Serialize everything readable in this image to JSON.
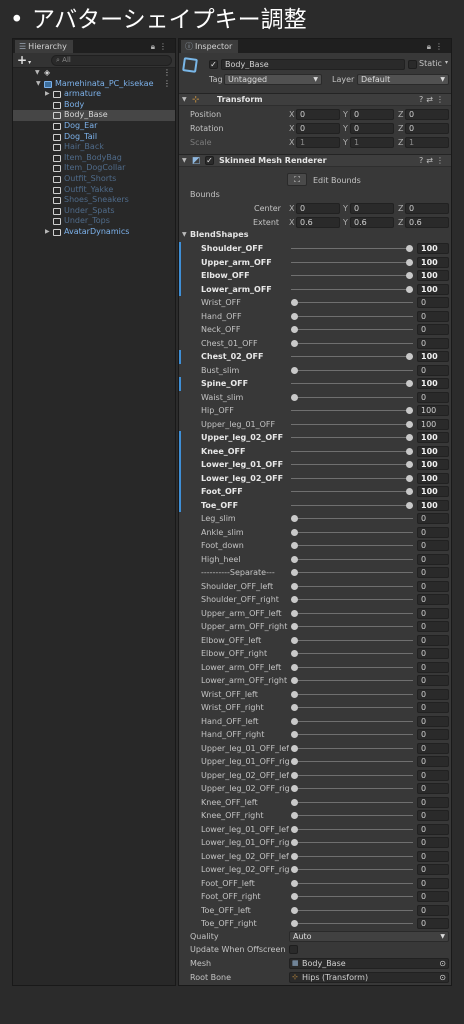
{
  "slide": {
    "bullet": "•",
    "title": "アバターシェイプキー調整"
  },
  "hierarchy": {
    "tab_label": "Hierarchy",
    "tab_icon": "list-icon",
    "lock_icon": "lock-icon",
    "menu_icon": "kebab-menu-icon",
    "add_icon": "plus-icon",
    "search_placeholder": "All",
    "scene_icon": "unity-scene-icon",
    "items": [
      {
        "name": "Mamehinata_PC_kisekae",
        "color": "#7cb1ea"
      },
      {
        "name": "armature",
        "color": "#7cb1ea"
      },
      {
        "name": "Body",
        "color": "#7cb1ea"
      },
      {
        "name": "Body_Base",
        "color": "#d8d8d8",
        "selected": true
      },
      {
        "name": "Dog_Ear",
        "color": "#7cb1ea"
      },
      {
        "name": "Dog_Tail",
        "color": "#7cb1ea"
      },
      {
        "name": "Hair_Back",
        "color": "#4f6b8a"
      },
      {
        "name": "Item_BodyBag",
        "color": "#4f6b8a"
      },
      {
        "name": "Item_DogCollar",
        "color": "#4f6b8a"
      },
      {
        "name": "Outfit_Shorts",
        "color": "#4f6b8a"
      },
      {
        "name": "Outfit_Yakke",
        "color": "#4f6b8a"
      },
      {
        "name": "Shoes_Sneakers",
        "color": "#4f6b8a"
      },
      {
        "name": "Under_Spats",
        "color": "#4f6b8a"
      },
      {
        "name": "Under_Tops",
        "color": "#4f6b8a"
      },
      {
        "name": "AvatarDynamics",
        "color": "#7cb1ea"
      }
    ]
  },
  "inspector": {
    "tab_label": "Inspector",
    "tab_icon": "info-icon",
    "object_name": "Body_Base",
    "static_label": "Static",
    "tag_label": "Tag",
    "tag_value": "Untagged",
    "layer_label": "Layer",
    "layer_value": "Default",
    "transform": {
      "title": "Transform",
      "position_label": "Position",
      "rotation_label": "Rotation",
      "scale_label": "Scale",
      "x": "X",
      "y": "Y",
      "z": "Z",
      "position": [
        "0",
        "0",
        "0"
      ],
      "rotation": [
        "0",
        "0",
        "0"
      ],
      "scale": [
        "1",
        "1",
        "1"
      ]
    },
    "smr": {
      "title": "Skinned Mesh Renderer",
      "edit_bounds": "Edit Bounds",
      "bounds_label": "Bounds",
      "center_label": "Center",
      "extent_label": "Extent",
      "center": [
        "0",
        "0",
        "0"
      ],
      "extent": [
        "0.6",
        "0.6",
        "0.6"
      ],
      "blendshapes_label": "BlendShapes",
      "quality_label": "Quality",
      "quality_value": "Auto",
      "update_offscreen_label": "Update When Offscreen",
      "mesh_label": "Mesh",
      "mesh_value": "Body_Base",
      "root_bone_label": "Root Bone",
      "root_bone_value": "Hips (Transform)"
    }
  },
  "blendshapes": [
    {
      "name": "Shoulder_OFF",
      "value": 100,
      "modified": true
    },
    {
      "name": "Upper_arm_OFF",
      "value": 100,
      "modified": true
    },
    {
      "name": "Elbow_OFF",
      "value": 100,
      "modified": true
    },
    {
      "name": "Lower_arm_OFF",
      "value": 100,
      "modified": true
    },
    {
      "name": "Wrist_OFF",
      "value": 0,
      "modified": false
    },
    {
      "name": "Hand_OFF",
      "value": 0,
      "modified": false
    },
    {
      "name": "Neck_OFF",
      "value": 0,
      "modified": false
    },
    {
      "name": "Chest_01_OFF",
      "value": 0,
      "modified": false
    },
    {
      "name": "Chest_02_OFF",
      "value": 100,
      "modified": true
    },
    {
      "name": "Bust_slim",
      "value": 0,
      "modified": false
    },
    {
      "name": "Spine_OFF",
      "value": 100,
      "modified": true
    },
    {
      "name": "Waist_slim",
      "value": 0,
      "modified": false
    },
    {
      "name": "Hip_OFF",
      "value": 100,
      "modified": false
    },
    {
      "name": "Upper_leg_01_OFF",
      "value": 100,
      "modified": false
    },
    {
      "name": "Upper_leg_02_OFF",
      "value": 100,
      "modified": true
    },
    {
      "name": "Knee_OFF",
      "value": 100,
      "modified": true
    },
    {
      "name": "Lower_leg_01_OFF",
      "value": 100,
      "modified": true
    },
    {
      "name": "Lower_leg_02_OFF",
      "value": 100,
      "modified": true
    },
    {
      "name": "Foot_OFF",
      "value": 100,
      "modified": true
    },
    {
      "name": "Toe_OFF",
      "value": 100,
      "modified": true
    },
    {
      "name": "Leg_slim",
      "value": 0,
      "modified": false
    },
    {
      "name": "Ankle_slim",
      "value": 0,
      "modified": false
    },
    {
      "name": "Foot_down",
      "value": 0,
      "modified": false
    },
    {
      "name": "High_heel",
      "value": 0,
      "modified": false
    },
    {
      "name": "----------Separate---",
      "value": 0,
      "modified": false
    },
    {
      "name": "Shoulder_OFF_left",
      "value": 0,
      "modified": false
    },
    {
      "name": "Shoulder_OFF_right",
      "value": 0,
      "modified": false
    },
    {
      "name": "Upper_arm_OFF_left",
      "value": 0,
      "modified": false
    },
    {
      "name": "Upper_arm_OFF_right",
      "value": 0,
      "modified": false
    },
    {
      "name": "Elbow_OFF_left",
      "value": 0,
      "modified": false
    },
    {
      "name": "Elbow_OFF_right",
      "value": 0,
      "modified": false
    },
    {
      "name": "Lower_arm_OFF_left",
      "value": 0,
      "modified": false
    },
    {
      "name": "Lower_arm_OFF_right",
      "value": 0,
      "modified": false
    },
    {
      "name": "Wrist_OFF_left",
      "value": 0,
      "modified": false
    },
    {
      "name": "Wrist_OFF_right",
      "value": 0,
      "modified": false
    },
    {
      "name": "Hand_OFF_left",
      "value": 0,
      "modified": false
    },
    {
      "name": "Hand_OFF_right",
      "value": 0,
      "modified": false
    },
    {
      "name": "Upper_leg_01_OFF_left",
      "value": 0,
      "modified": false
    },
    {
      "name": "Upper_leg_01_OFF_righ",
      "value": 0,
      "modified": false
    },
    {
      "name": "Upper_leg_02_OFF_left",
      "value": 0,
      "modified": false
    },
    {
      "name": "Upper_leg_02_OFF_righ",
      "value": 0,
      "modified": false
    },
    {
      "name": "Knee_OFF_left",
      "value": 0,
      "modified": false
    },
    {
      "name": "Knee_OFF_right",
      "value": 0,
      "modified": false
    },
    {
      "name": "Lower_leg_01_OFF_left",
      "value": 0,
      "modified": false
    },
    {
      "name": "Lower_leg_01_OFF_righ",
      "value": 0,
      "modified": false
    },
    {
      "name": "Lower_leg_02_OFF_left",
      "value": 0,
      "modified": false
    },
    {
      "name": "Lower_leg_02_OFF_righ",
      "value": 0,
      "modified": false
    },
    {
      "name": "Foot_OFF_left",
      "value": 0,
      "modified": false
    },
    {
      "name": "Foot_OFF_right",
      "value": 0,
      "modified": false
    },
    {
      "name": "Toe_OFF_left",
      "value": 0,
      "modified": false
    },
    {
      "name": "Toe_OFF_right",
      "value": 0,
      "modified": false
    }
  ]
}
